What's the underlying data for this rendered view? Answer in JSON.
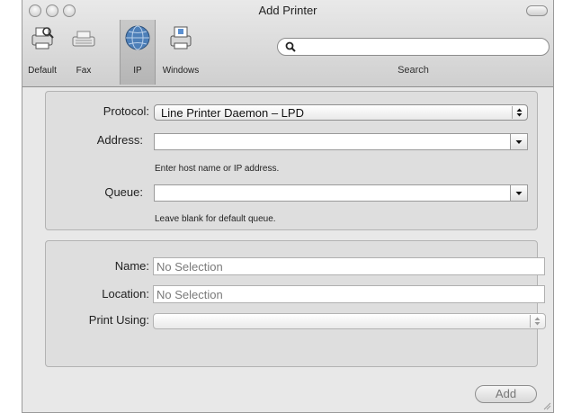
{
  "background_fragments": [
    "e",
    "e",
    "e"
  ],
  "window": {
    "title": "Add Printer"
  },
  "toolbar": {
    "items": [
      {
        "label": "Default",
        "icon": "printer-default-icon"
      },
      {
        "label": "Fax",
        "icon": "fax-icon"
      },
      {
        "label": "IP",
        "icon": "globe-icon",
        "selected": true
      },
      {
        "label": "Windows",
        "icon": "windows-printer-icon"
      }
    ],
    "search": {
      "value": "",
      "label": "Search"
    }
  },
  "connection": {
    "protocol_label": "Protocol:",
    "protocol_value": "Line Printer Daemon – LPD",
    "address_label": "Address:",
    "address_value": "",
    "address_hint": "Enter host name or IP address.",
    "queue_label": "Queue:",
    "queue_value": "",
    "queue_hint": "Leave blank for default queue."
  },
  "details": {
    "name_label": "Name:",
    "name_value": "No Selection",
    "location_label": "Location:",
    "location_value": "No Selection",
    "print_using_label": "Print Using:",
    "print_using_value": ""
  },
  "actions": {
    "add_label": "Add"
  }
}
